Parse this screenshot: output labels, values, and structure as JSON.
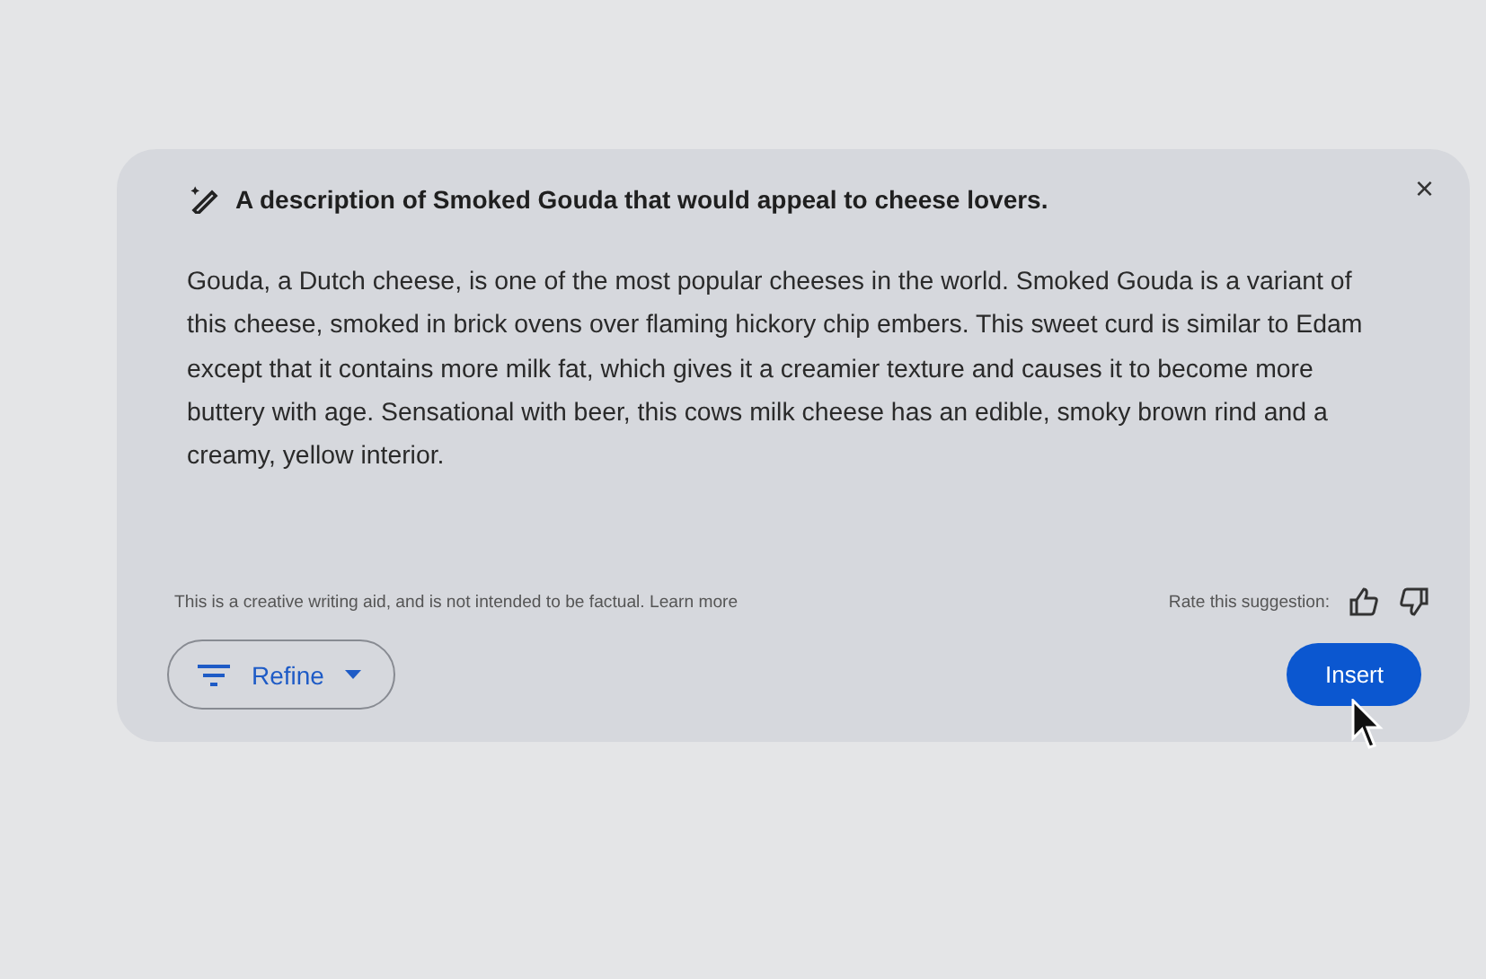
{
  "prompt": "A description of Smoked Gouda that would appeal to cheese lovers.",
  "close": "×",
  "body": "Gouda, a Dutch cheese, is one of the most popular cheeses in the world. Smoked Gouda is a variant of this cheese, smoked in brick ovens over flaming hickory chip embers. This sweet curd is similar to Edam except that it contains more milk fat, which gives it a creamier texture and causes it to become more buttery with age. Sensational with beer, this cows milk cheese has an edible, smoky brown rind and a creamy, yellow interior.",
  "disclaimer": "This is a creative writing aid, and is not intended to be factual.",
  "learn_more": "Learn more",
  "rate_label": "Rate this suggestion:",
  "refine_button": "Refine",
  "insert_button": "Insert"
}
